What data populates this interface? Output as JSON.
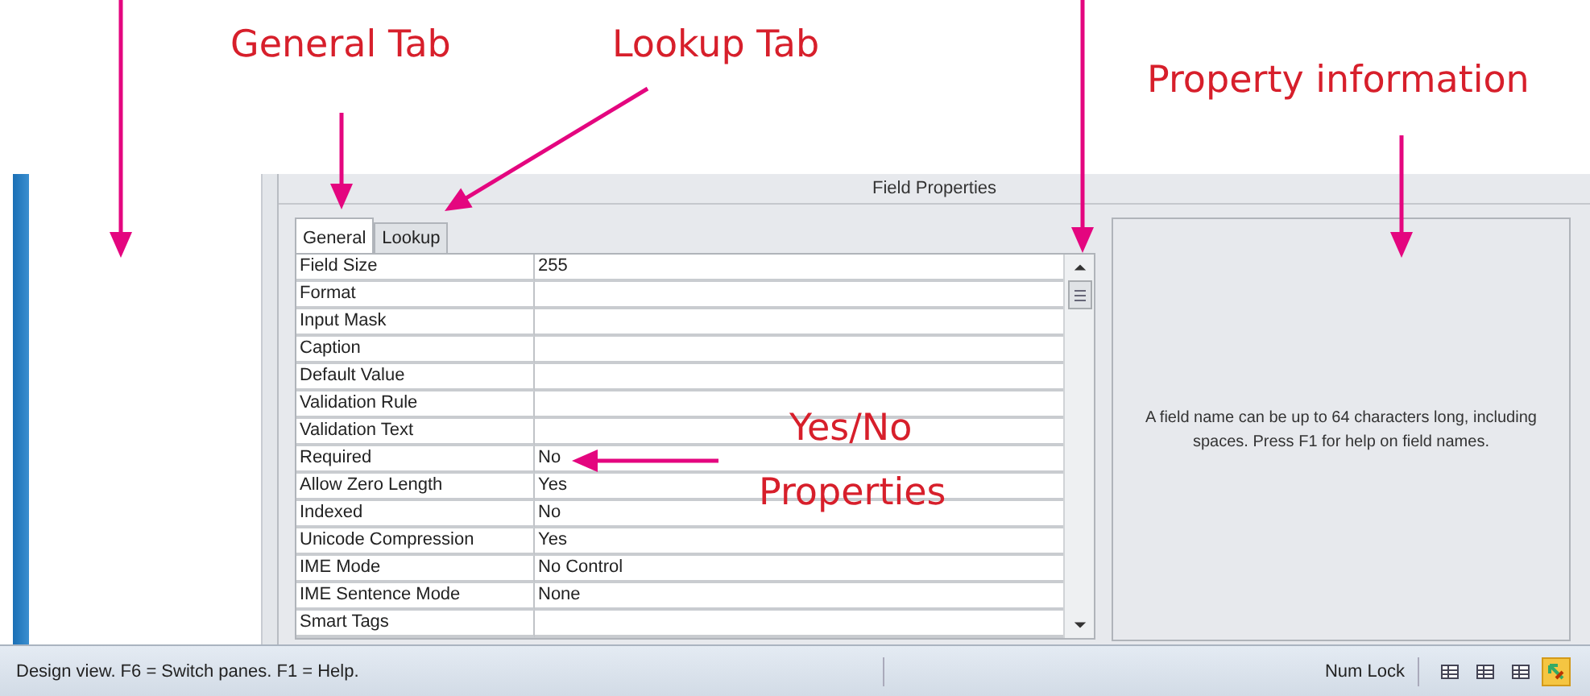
{
  "callouts": [
    {
      "text": "General Tab"
    },
    {
      "text": "Lookup Tab"
    },
    {
      "text": "Property information"
    },
    {
      "text": "Yes/No"
    },
    {
      "text": "Properties"
    }
  ],
  "field_properties": {
    "title": "Field Properties",
    "tabs": [
      {
        "label": "General",
        "selected": true
      },
      {
        "label": "Lookup",
        "selected": false
      }
    ],
    "rows": [
      {
        "name": "Field Size",
        "value": "255"
      },
      {
        "name": "Format",
        "value": ""
      },
      {
        "name": "Input Mask",
        "value": ""
      },
      {
        "name": "Caption",
        "value": ""
      },
      {
        "name": "Default Value",
        "value": ""
      },
      {
        "name": "Validation Rule",
        "value": ""
      },
      {
        "name": "Validation Text",
        "value": ""
      },
      {
        "name": "Required",
        "value": "No"
      },
      {
        "name": "Allow Zero Length",
        "value": "Yes"
      },
      {
        "name": "Indexed",
        "value": "No"
      },
      {
        "name": "Unicode Compression",
        "value": "Yes"
      },
      {
        "name": "IME Mode",
        "value": "No Control"
      },
      {
        "name": "IME Sentence Mode",
        "value": "None"
      },
      {
        "name": "Smart Tags",
        "value": ""
      }
    ],
    "help_text": "A field name can be up to 64 characters long, including spaces. Press F1 for help on field names."
  },
  "status_bar": {
    "message": "Design view.  F6 = Switch panes.  F1 = Help.",
    "num_lock": "Num Lock",
    "views": [
      {
        "selected": false
      },
      {
        "selected": false
      },
      {
        "selected": false
      },
      {
        "selected": true
      }
    ]
  }
}
